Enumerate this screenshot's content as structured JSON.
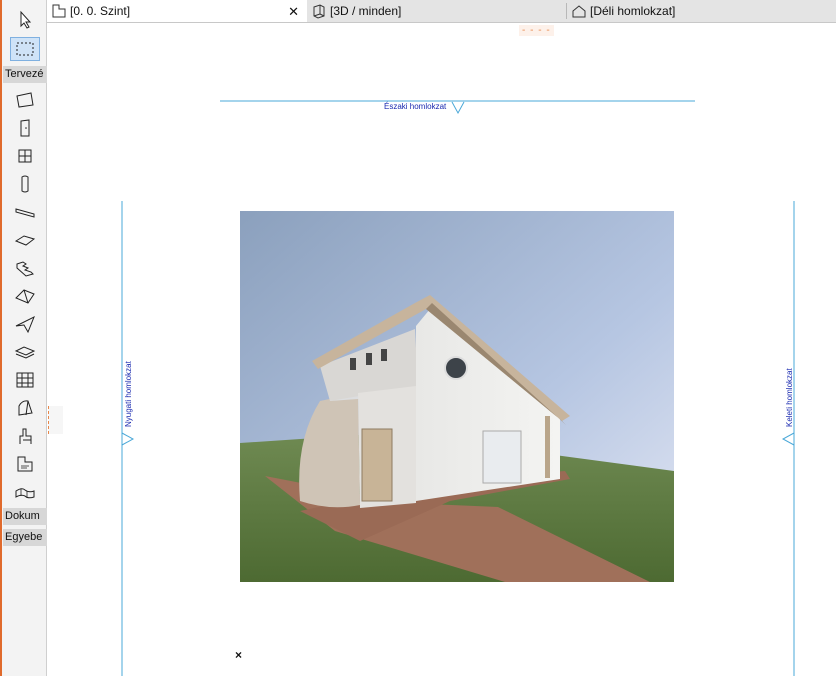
{
  "toolbox": {
    "sections": [
      {
        "label": "Tervezé"
      },
      {
        "label": "Dokum"
      },
      {
        "label": "Egyebe"
      }
    ],
    "tools": [
      {
        "name": "arrow-tool-icon"
      },
      {
        "name": "marquee-tool-icon"
      },
      {
        "name": "wall-tool-icon"
      },
      {
        "name": "door-tool-icon"
      },
      {
        "name": "window-tool-icon"
      },
      {
        "name": "column-tool-icon"
      },
      {
        "name": "beam-tool-icon"
      },
      {
        "name": "slab-tool-icon"
      },
      {
        "name": "stair-tool-icon"
      },
      {
        "name": "roof-tool-icon"
      },
      {
        "name": "shell-tool-icon"
      },
      {
        "name": "mesh-tool-icon"
      },
      {
        "name": "curtain-wall-tool-icon"
      },
      {
        "name": "morph-tool-icon"
      },
      {
        "name": "object-tool-icon"
      },
      {
        "name": "zone-tool-icon"
      },
      {
        "name": "terrain-mesh-tool-icon"
      }
    ]
  },
  "tabs": [
    {
      "label": "[0. 0. Szint]",
      "icon": "floor-plan-icon",
      "active": true,
      "close": "✕"
    },
    {
      "label": "[3D / minden]",
      "icon": "3d-view-icon",
      "active": false
    },
    {
      "label": "[Déli homlokzat]",
      "icon": "elevation-house-icon",
      "active": false
    }
  ],
  "canvas": {
    "markers": {
      "north": "Északi homlokzat",
      "west": "Nyugati homlokzat",
      "east": "Keleti homlokzat"
    },
    "origin_mark": "×",
    "dash_top": "- - - -",
    "dash_left": "¦"
  },
  "colors": {
    "accent": "#e06a2c",
    "marker_line": "#4aa8d8",
    "marker_text": "#1a2ab0",
    "tab_bg": "#e4e4e4"
  }
}
